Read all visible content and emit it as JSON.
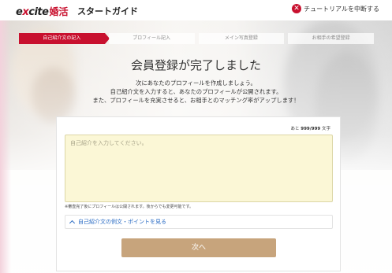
{
  "header": {
    "logo_text": "excite",
    "logo_kanji": "婚活",
    "title": "スタートガイド",
    "quit_label": "チュートリアルを中断する"
  },
  "steps": [
    {
      "label": "自己紹介文の記入",
      "active": true
    },
    {
      "label": "プロフィール記入",
      "active": false
    },
    {
      "label": "メイン写真登録",
      "active": false
    },
    {
      "label": "お相手の希望登録",
      "active": false
    }
  ],
  "main": {
    "title": "会員登録が完了しました",
    "desc_lines": [
      "次にあなたのプロフィールを作成しましょう。",
      "自己紹介文を入力すると、あなたのプロフィールが公開されます。",
      "また、プロフィールを充実させると、お相手とのマッチング率がアップします！"
    ]
  },
  "form": {
    "counter_prefix": "あと",
    "counter_value": "999/999",
    "counter_suffix": "文字",
    "textarea_placeholder": "自己紹介を入力してください。",
    "textarea_value": "",
    "note": "※審査完了後にプロフィールは公開されます。後からでも変更可能です。",
    "example_label": "自己紹介文の例文・ポイントを見る",
    "next_label": "次へ"
  },
  "colors": {
    "brand_red": "#c8102e",
    "button_tan": "#c7a47c",
    "link_blue": "#2b6cc4",
    "textarea_bg": "#fbf7d6"
  },
  "icons": {
    "quit": "close-circle-icon",
    "example_toggle": "chevron-up-icon"
  }
}
